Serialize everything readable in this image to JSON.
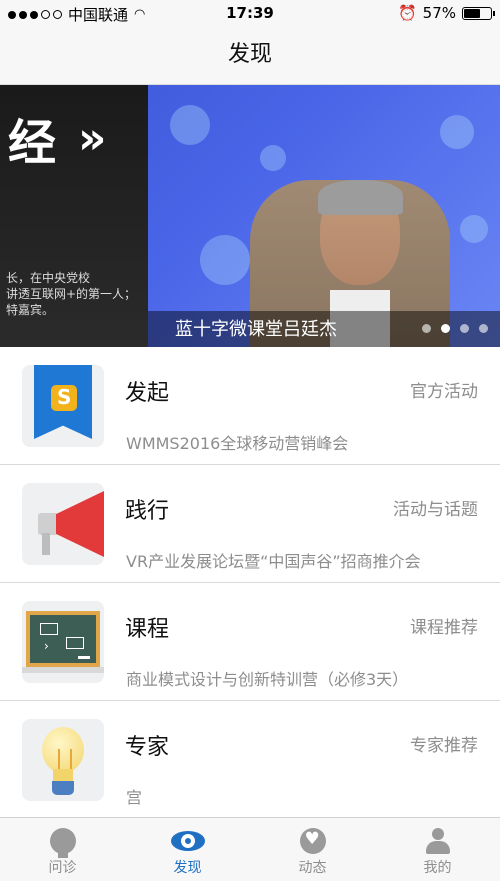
{
  "status_bar": {
    "carrier": "中国联通",
    "time": "17:39",
    "battery": "57%",
    "battery_level": 0.57
  },
  "header": {
    "title": "发现"
  },
  "banner": {
    "caption": "蓝十字微课堂吕廷杰",
    "headline_glyph": "经",
    "side_text": "长，在中央党校\n讲透互联网+的第一人；\n特嘉宾。",
    "pages": 4,
    "active_page": 2
  },
  "items": [
    {
      "name": "发起",
      "tag": "官方活动",
      "desc": "WMMS2016全球移动营销峰会",
      "icon": "flag-badge-icon"
    },
    {
      "name": "践行",
      "tag": "活动与话题",
      "desc": "VR产业发展论坛暨“中国声谷”招商推介会",
      "icon": "megaphone-icon"
    },
    {
      "name": "课程",
      "tag": "课程推荐",
      "desc": "商业模式设计与创新特训营（必修3天）",
      "icon": "blackboard-icon"
    },
    {
      "name": "专家",
      "tag": "专家推荐",
      "desc": "宫",
      "icon": "lightbulb-icon"
    }
  ],
  "tabs": [
    {
      "label": "问诊",
      "icon": "bulb-icon",
      "active": false
    },
    {
      "label": "发现",
      "icon": "eye-icon",
      "active": true
    },
    {
      "label": "动态",
      "icon": "heart-icon",
      "active": false
    },
    {
      "label": "我的",
      "icon": "person-icon",
      "active": false
    }
  ],
  "colors": {
    "accent": "#1f6fc2",
    "tag_gray": "#8d8d8d",
    "horn_red": "#e23a3a"
  }
}
